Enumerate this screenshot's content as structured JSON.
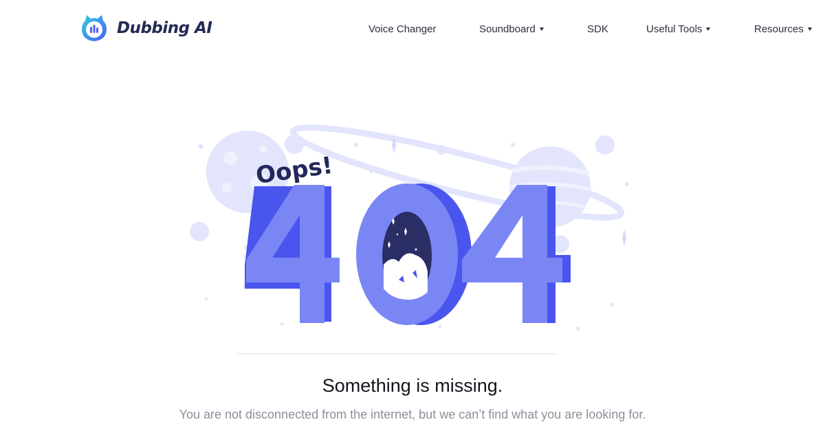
{
  "brand": {
    "name": "Dubbing AI",
    "logo_icon": "dubbing-ai-logo-icon",
    "colors": {
      "primary": "#4d5ef7",
      "accent": "#30cfe0",
      "text": "#232a52"
    }
  },
  "nav": {
    "items": [
      {
        "label": "Voice Changer",
        "has_dropdown": false
      },
      {
        "label": "Soundboard",
        "has_dropdown": true
      },
      {
        "label": "SDK",
        "has_dropdown": false
      },
      {
        "label": "Useful Tools",
        "has_dropdown": true
      },
      {
        "label": "Resources",
        "has_dropdown": true
      }
    ]
  },
  "error": {
    "illustration": {
      "exclamation": "Oops!",
      "code": "404",
      "colors": {
        "digit_face": "#7b86f5",
        "digit_side": "#4a55ed",
        "planet": "#e2e5fc"
      }
    },
    "title": "Something is missing.",
    "message": "You are not disconnected from the internet, but we can’t find what you are looking for."
  }
}
